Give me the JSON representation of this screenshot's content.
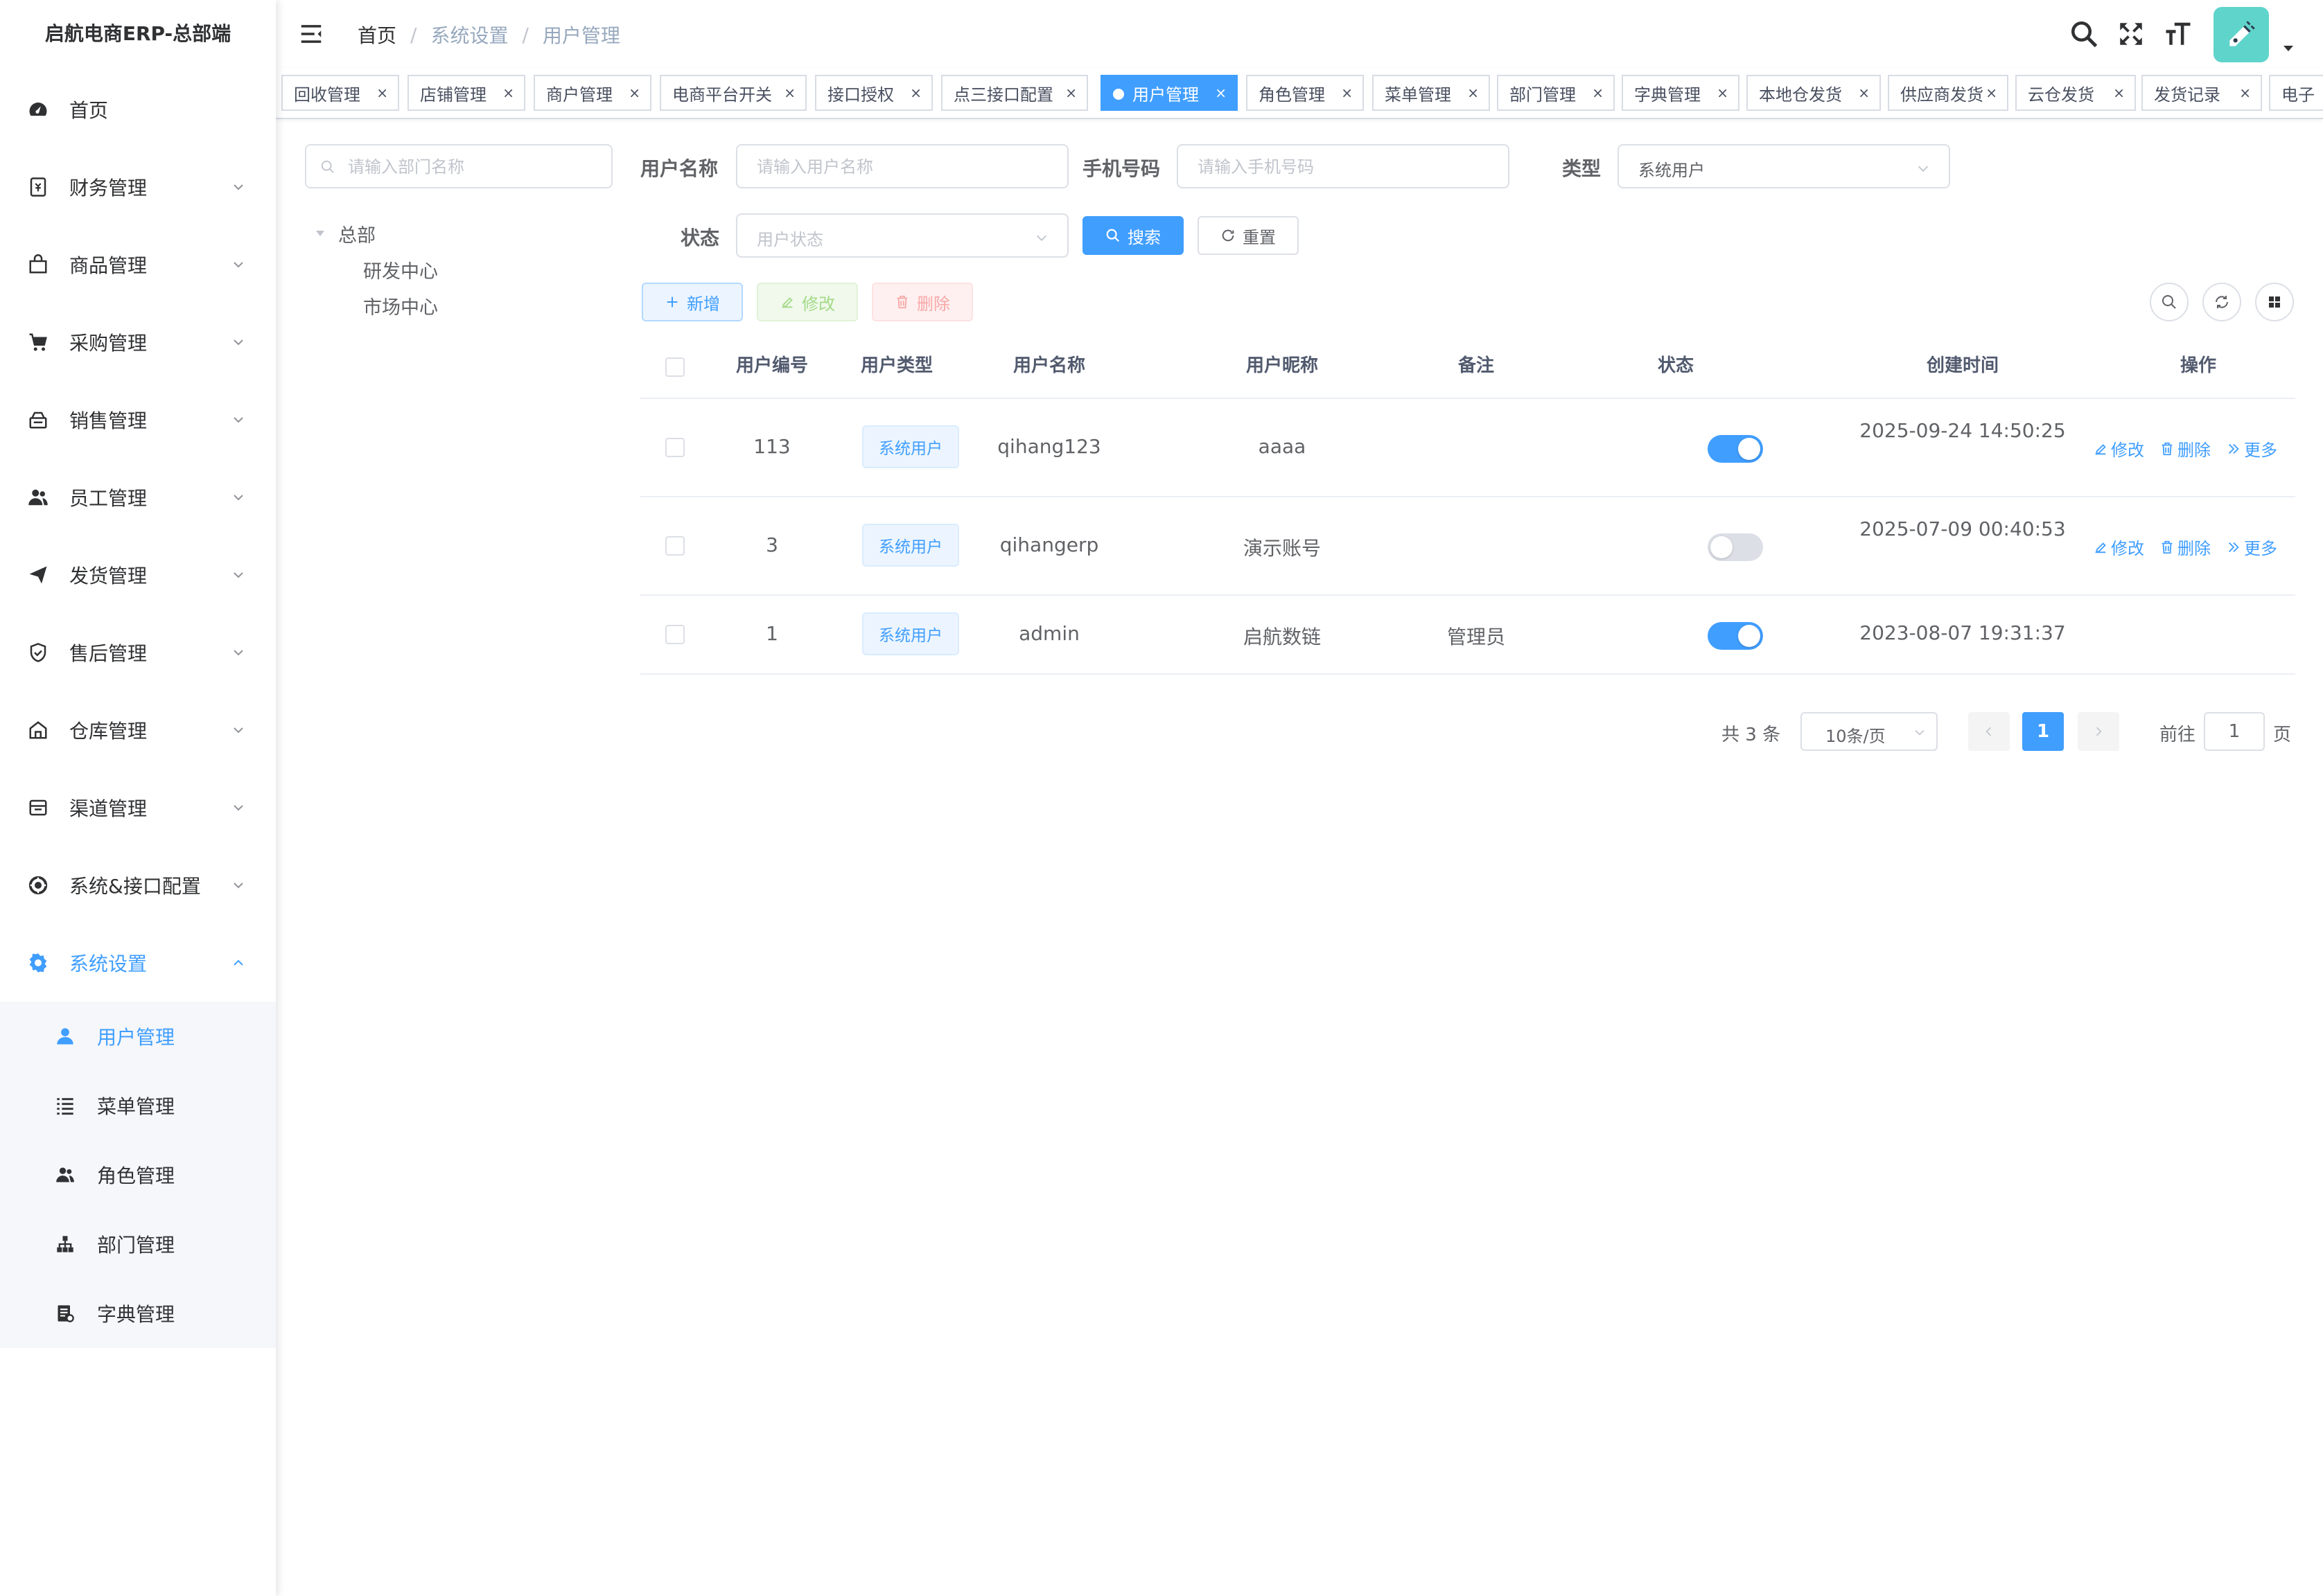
{
  "app": {
    "title": "启航电商ERP-总部端"
  },
  "sidebar": {
    "items": [
      {
        "label": "首页",
        "icon": "dashboard-icon"
      },
      {
        "label": "财务管理",
        "icon": "finance-icon"
      },
      {
        "label": "商品管理",
        "icon": "goods-icon"
      },
      {
        "label": "采购管理",
        "icon": "cart-icon"
      },
      {
        "label": "销售管理",
        "icon": "sales-icon"
      },
      {
        "label": "员工管理",
        "icon": "peoples-icon"
      },
      {
        "label": "发货管理",
        "icon": "send-icon"
      },
      {
        "label": "售后管理",
        "icon": "shield-icon"
      },
      {
        "label": "仓库管理",
        "icon": "warehouse-icon"
      },
      {
        "label": "渠道管理",
        "icon": "channel-icon"
      },
      {
        "label": "系统&接口配置",
        "icon": "interface-icon"
      },
      {
        "label": "系统设置",
        "icon": "gear-icon"
      }
    ],
    "submenu": [
      {
        "label": "用户管理",
        "icon": "user-icon"
      },
      {
        "label": "菜单管理",
        "icon": "tree-table-icon"
      },
      {
        "label": "角色管理",
        "icon": "peoples-icon"
      },
      {
        "label": "部门管理",
        "icon": "org-tree-icon"
      },
      {
        "label": "字典管理",
        "icon": "dict-icon"
      }
    ]
  },
  "header": {
    "breadcrumb": [
      "首页",
      "系统设置",
      "用户管理"
    ],
    "icons": [
      "search-icon",
      "fullscreen-icon",
      "font-size-icon"
    ]
  },
  "tags": [
    {
      "label": "回收管理"
    },
    {
      "label": "店铺管理"
    },
    {
      "label": "商户管理"
    },
    {
      "label": "电商平台开关"
    },
    {
      "label": "接口授权"
    },
    {
      "label": "点三接口配置"
    },
    {
      "label": "用户管理",
      "active": true
    },
    {
      "label": "角色管理"
    },
    {
      "label": "菜单管理"
    },
    {
      "label": "部门管理"
    },
    {
      "label": "字典管理"
    },
    {
      "label": "本地仓发货"
    },
    {
      "label": "供应商发货"
    },
    {
      "label": "云仓发货"
    },
    {
      "label": "发货记录"
    },
    {
      "label": "电子"
    }
  ],
  "dept_tree": {
    "search_placeholder": "请输入部门名称",
    "root": "总部",
    "children": [
      "研发中心",
      "市场中心"
    ]
  },
  "search_form": {
    "username_label": "用户名称",
    "username_placeholder": "请输入用户名称",
    "phone_label": "手机号码",
    "phone_placeholder": "请输入手机号码",
    "type_label": "类型",
    "type_value": "系统用户",
    "status_label": "状态",
    "status_placeholder": "用户状态",
    "search_button": "搜索",
    "reset_button": "重置"
  },
  "toolbar": {
    "add": "新增",
    "edit": "修改",
    "delete": "删除"
  },
  "table": {
    "headers": [
      "用户编号",
      "用户类型",
      "用户名称",
      "用户昵称",
      "备注",
      "状态",
      "创建时间",
      "操作"
    ],
    "rows": [
      {
        "id": "113",
        "type": "系统用户",
        "username": "qihang123",
        "nickname": "aaaa",
        "remark": "",
        "status_on": true,
        "created": "2025-09-24 14:50:25",
        "has_actions": true
      },
      {
        "id": "3",
        "type": "系统用户",
        "username": "qihangerp",
        "nickname": "演示账号",
        "remark": "",
        "status_on": false,
        "created": "2025-07-09 00:40:53",
        "has_actions": true
      },
      {
        "id": "1",
        "type": "系统用户",
        "username": "admin",
        "nickname": "启航数链",
        "remark": "管理员",
        "status_on": true,
        "created": "2023-08-07 19:31:37",
        "has_actions": false
      }
    ],
    "actions": {
      "edit": "修改",
      "delete": "删除",
      "more": "更多"
    }
  },
  "pagination": {
    "total_text": "共 3 条",
    "page_size": "10条/页",
    "current_page": "1",
    "goto_prefix": "前往",
    "goto_value": "1",
    "goto_suffix": "页"
  },
  "colors": {
    "primary": "#409eff",
    "text": "#303133",
    "muted": "#97a8be",
    "avatar_bg": "#5fd4cb"
  }
}
